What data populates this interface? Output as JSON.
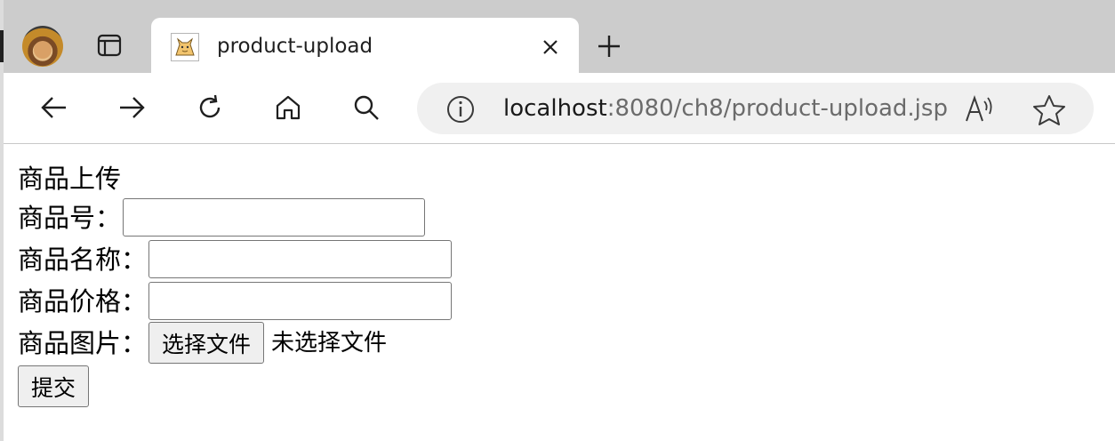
{
  "browser": {
    "tab": {
      "title": "product-upload",
      "icon": "tomcat-favicon"
    },
    "address": {
      "host": "localhost",
      "rest": ":8080/ch8/product-upload.jsp"
    }
  },
  "form": {
    "heading": "商品上传",
    "fields": [
      {
        "label": "商品号：",
        "value": ""
      },
      {
        "label": "商品名称：",
        "value": ""
      },
      {
        "label": "商品价格：",
        "value": ""
      }
    ],
    "image": {
      "label": "商品图片：",
      "button": "选择文件",
      "status": "未选择文件"
    },
    "submit": "提交"
  }
}
